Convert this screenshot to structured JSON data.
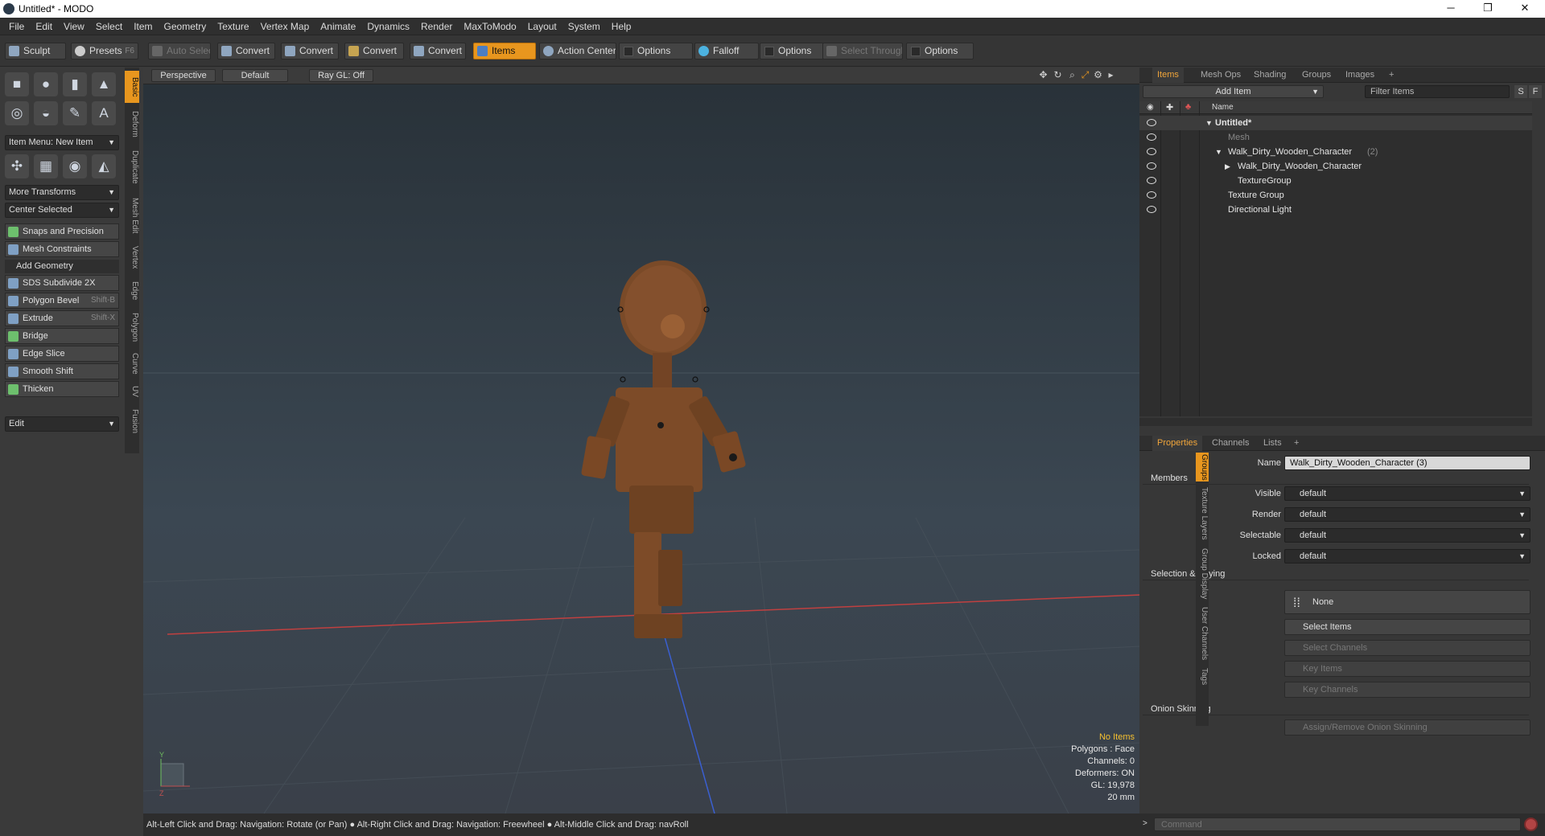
{
  "window": {
    "title": "Untitled* - MODO",
    "minimize": "─",
    "maximize": "❐",
    "close": "✕"
  },
  "menu": [
    "File",
    "Edit",
    "View",
    "Select",
    "Item",
    "Geometry",
    "Texture",
    "Vertex Map",
    "Animate",
    "Dynamics",
    "Render",
    "MaxToModo",
    "Layout",
    "System",
    "Help"
  ],
  "toolbar": {
    "sculpt": "Sculpt",
    "presets": "Presets",
    "presets_key": "F6",
    "auto_select": "Auto Select",
    "convert1": "Convert",
    "convert2": "Convert",
    "convert3": "Convert",
    "convert4": "Convert",
    "items": "Items",
    "action_center": "Action Center",
    "options1": "Options",
    "falloff": "Falloff",
    "options2": "Options",
    "select_through": "Select Through",
    "options3": "Options"
  },
  "left": {
    "tabs": [
      "Basic",
      "Deform",
      "Duplicate",
      "Mesh Edit",
      "Vertex",
      "Edge",
      "Polygon",
      "Curve",
      "UV",
      "Fusion"
    ],
    "item_menu": "Item Menu: New Item",
    "more_transforms": "More Transforms",
    "center_selected": "Center Selected",
    "snaps": "Snaps and Precision",
    "mesh_constraints": "Mesh Constraints",
    "add_geometry": "Add Geometry",
    "tools": [
      {
        "label": "SDS Subdivide 2X",
        "key": ""
      },
      {
        "label": "Polygon Bevel",
        "key": "Shift-B"
      },
      {
        "label": "Extrude",
        "key": "Shift-X"
      },
      {
        "label": "Bridge",
        "key": ""
      },
      {
        "label": "Edge Slice",
        "key": ""
      },
      {
        "label": "Smooth Shift",
        "key": ""
      },
      {
        "label": "Thicken",
        "key": ""
      }
    ],
    "edit_dropdown": "Edit"
  },
  "viewport": {
    "perspective": "Perspective",
    "default": "Default",
    "raygl": "Ray GL: Off",
    "hud": {
      "no_items": "No Items",
      "polygons": "Polygons : Face",
      "channels": "Channels: 0",
      "deformers": "Deformers: ON",
      "gl": "GL: 19,978",
      "scale": "20 mm"
    },
    "axis_y": "Y",
    "axis_z": "Z"
  },
  "status": "Alt-Left Click and Drag: Navigation: Rotate (or Pan) ● Alt-Right Click and Drag: Navigation: Freewheel ● Alt-Middle Click and Drag: navRoll",
  "items_panel": {
    "tabs": [
      "Items",
      "Mesh Ops",
      "Shading",
      "Groups",
      "Images"
    ],
    "add_item": "Add Item",
    "filter": "Filter Items",
    "s": "S",
    "f": "F",
    "name_col": "Name",
    "tree": [
      {
        "label": "Untitled*",
        "indent": 0
      },
      {
        "label": "Mesh",
        "indent": 1
      },
      {
        "label": "Walk_Dirty_Wooden_Character",
        "count": "(2)",
        "indent": 1
      },
      {
        "label": "Walk_Dirty_Wooden_Character",
        "indent": 2
      },
      {
        "label": "TextureGroup",
        "indent": 2
      },
      {
        "label": "Texture Group",
        "indent": 1
      },
      {
        "label": "Directional Light",
        "indent": 1
      }
    ]
  },
  "props_panel": {
    "tabs": [
      "Properties",
      "Channels",
      "Lists"
    ],
    "name_label": "Name",
    "name_value": "Walk_Dirty_Wooden_Character (3)",
    "members": "Members",
    "visible_label": "Visible",
    "visible": "default",
    "render_label": "Render",
    "render": "default",
    "selectable_label": "Selectable",
    "selectable": "default",
    "locked_label": "Locked",
    "locked": "default",
    "selection_keying": "Selection & Keying",
    "none": "None",
    "select_items": "Select Items",
    "select_channels": "Select Channels",
    "key_items": "Key Items",
    "key_channels": "Key Channels",
    "onion": "Onion Skinning",
    "assign_onion": "Assign/Remove Onion Skinning",
    "side_tabs": [
      "Groups",
      "Texture Layers",
      "Group Display",
      "User Channels",
      "Tags"
    ]
  },
  "command": {
    "placeholder": "Command"
  }
}
